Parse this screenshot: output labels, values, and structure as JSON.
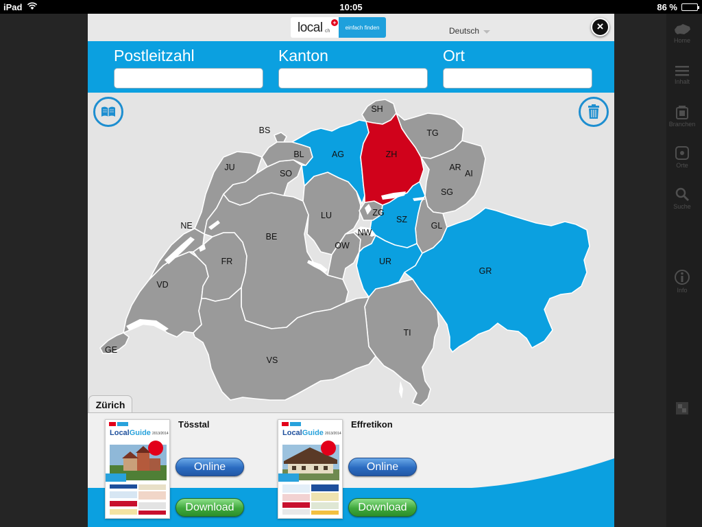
{
  "status_bar": {
    "device": "iPad",
    "time": "10:05",
    "battery": "86 %",
    "battery_level": 0.86
  },
  "header": {
    "logo_word": "local",
    "logo_suffix": "ch",
    "logo_plus": "+",
    "logo_tagline": "einfach finden",
    "language": "Deutsch",
    "close_symbol": "×"
  },
  "search": {
    "postleitzahl_label": "Postleitzahl",
    "kanton_label": "Kanton",
    "ort_label": "Ort",
    "postleitzahl_value": "",
    "kanton_value": "",
    "ort_value": ""
  },
  "map": {
    "colors": {
      "grey": "#9a9a9a",
      "blue": "#0ba0e0",
      "red": "#d0021b",
      "border": "#ffffff"
    },
    "cantons": {
      "SH": "SH",
      "TG": "TG",
      "BS": "BS",
      "BL": "BL",
      "AG": "AG",
      "ZH": "ZH",
      "JU": "JU",
      "SO": "SO",
      "AR": "AR",
      "AI": "AI",
      "SG": "SG",
      "ZG": "ZG",
      "LU": "LU",
      "SZ": "SZ",
      "GL": "GL",
      "NE": "NE",
      "BE": "BE",
      "NW": "NW",
      "OW": "OW",
      "UR": "UR",
      "FR": "FR",
      "GR": "GR",
      "VD": "VD",
      "TI": "TI",
      "GE": "GE",
      "VS": "VS"
    },
    "selected": "ZH",
    "highlighted": [
      "AG",
      "SZ",
      "UR",
      "GR"
    ]
  },
  "region_tab": "Zürich",
  "guides": [
    {
      "title": "Tösstal",
      "online_label": "Online",
      "download_label": "Download",
      "cover_brand": "Local",
      "cover_brand2": "Guide",
      "cover_year": "2013/2014"
    },
    {
      "title": "Effretikon",
      "online_label": "Online",
      "download_label": "Download",
      "cover_brand": "Local",
      "cover_brand2": "Guide",
      "cover_year": "2013/2014"
    }
  ],
  "side_menu": [
    {
      "label": "Home",
      "icon": "swiss-map-icon"
    },
    {
      "label": "Inhalt",
      "icon": "list-icon"
    },
    {
      "label": "Branchen",
      "icon": "bag-icon"
    },
    {
      "label": "Orte",
      "icon": "location-icon"
    },
    {
      "label": "Suche",
      "icon": "search-icon"
    },
    {
      "label": "Info",
      "icon": "info-icon"
    }
  ]
}
